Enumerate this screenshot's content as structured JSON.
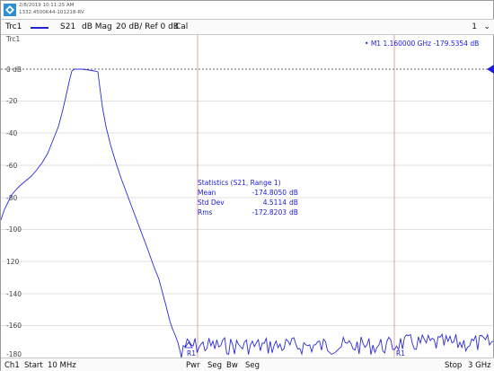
{
  "header": {
    "date": "2/8/2019 10:11:25 AM",
    "serial": "1332.4500K44-101218-RV"
  },
  "trace_bar": {
    "trace": "Trc1",
    "param": "S21",
    "format": "dB Mag",
    "scale": "20 dB/ Ref 0 dB",
    "cal": "Cal",
    "channel_num": "1"
  },
  "plot": {
    "ref_label": "Trc1",
    "y_labels": [
      "0 dB",
      "-20",
      "-40",
      "-60",
      "-80",
      "-100",
      "120",
      "-140",
      "-160",
      "-180"
    ],
    "marker": {
      "name": "M1",
      "freq": "1.160000",
      "freq_unit": "GHz",
      "value": "-179.5354",
      "value_unit": "dB"
    },
    "statistics": {
      "title": "Statistics  (S21, Range 1)",
      "rows": [
        {
          "label": "Mean",
          "value": "-174.8050",
          "unit": "dB"
        },
        {
          "label": "Std Dev",
          "value": "4.5114",
          "unit": "dB"
        },
        {
          "label": "Rms",
          "value": "-172.8203",
          "unit": "dB"
        }
      ]
    },
    "range_labels": [
      "R1",
      "R1"
    ],
    "trace_color": "#2a2ad6",
    "range_color": "#e09090"
  },
  "footer": {
    "ch": "Ch1",
    "start": "Start",
    "start_val": "10 MHz",
    "pwr": "Pwr",
    "seg1": "Seg",
    "bw": "Bw",
    "seg2": "Seg",
    "stop": "Stop",
    "stop_val": "3 GHz"
  },
  "icons": {
    "logo": "rohde-schwarz-logo",
    "dropdown": "chevron-down-icon",
    "ref_arrow": "reference-arrow-icon"
  }
}
